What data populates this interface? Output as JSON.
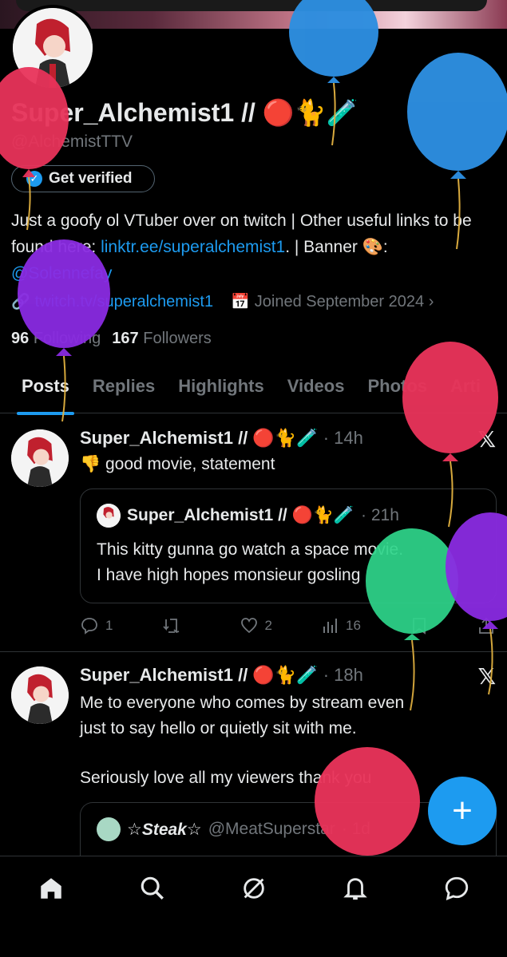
{
  "profile": {
    "display_name": "Super_Alchemist1 // 🔴🐈🧪",
    "handle": "@AlchemistTTV",
    "verified_label": "Get verified",
    "bio_prefix": "Just a goofy ol VTuber over on twitch | Other useful links to be found here: ",
    "bio_link": "linktr.ee/superalchemist1",
    "bio_mid": ". | Banner 🎨: ",
    "bio_mention": "@Solennefay",
    "website": "twitch.tv/superalchemist1",
    "joined": "Joined September 2024",
    "following_count": "96",
    "following_label": "Following",
    "followers_count": "167",
    "followers_label": "Followers"
  },
  "tabs": [
    "Posts",
    "Replies",
    "Highlights",
    "Videos",
    "Photos",
    "Arti"
  ],
  "posts": [
    {
      "author": "Super_Alchemist1 // 🔴🐈🧪",
      "time": "· 14h",
      "text": "👎 good movie, statement",
      "quote": {
        "author": "Super_Alchemist1 // 🔴🐈🧪",
        "time": "· 21h",
        "text_line1": "This kitty gunna go watch a space movie.",
        "text_line2": "I have high hopes monsieur gosling"
      },
      "replies": "1",
      "reposts": "",
      "likes": "2",
      "views": "16"
    },
    {
      "author": "Super_Alchemist1 // 🔴🐈🧪",
      "time": "· 18h",
      "text_line1": "Me to everyone who comes by stream even",
      "text_line2": "just to say hello or quietly sit with me.",
      "text_line3": "Seriously love all my viewers thank you",
      "quote": {
        "author": "☆Steak☆",
        "handle": "@MeatSuperstar",
        "time": "· 1d"
      }
    }
  ],
  "icons": {
    "reply": "reply-icon",
    "repost": "repost-icon",
    "like": "heart-icon",
    "views": "views-icon",
    "bookmark": "bookmark-icon",
    "share": "share-icon",
    "home": "home-icon",
    "search": "search-icon",
    "grok": "grok-icon",
    "notifications": "bell-icon",
    "messages": "messages-icon",
    "compose": "plus-icon"
  },
  "colors": {
    "accent": "#1d9bf0",
    "background": "#000000",
    "text": "#e7e9ea",
    "muted": "#71767b",
    "balloon_red": "#e8335a",
    "balloon_blue": "#2d8ee0",
    "balloon_purple": "#8a2be2",
    "balloon_green": "#2ed48a"
  }
}
